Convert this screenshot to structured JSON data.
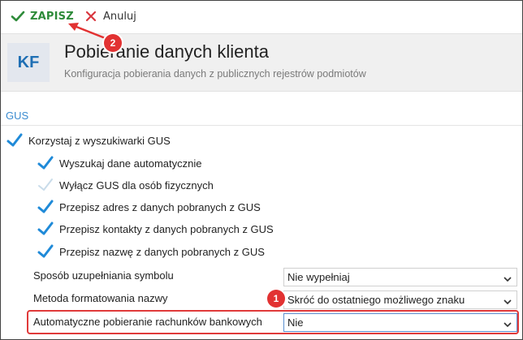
{
  "toolbar": {
    "save_label": "ZAPISZ",
    "cancel_label": "Anuluj"
  },
  "header": {
    "logo_text": "KF",
    "title": "Pobieranie danych klienta",
    "subtitle": "Konfiguracja pobierania danych z publicznych rejestrów podmiotów"
  },
  "section": {
    "title": "GUS"
  },
  "checkboxes": [
    {
      "label": "Korzystaj z wyszukiwarki GUS",
      "checked": true
    },
    {
      "label": "Wyszukaj dane automatycznie",
      "checked": true
    },
    {
      "label": "Wyłącz GUS dla osób fizycznych",
      "checked": false
    },
    {
      "label": "Przepisz adres z danych pobranych z GUS",
      "checked": true
    },
    {
      "label": "Przepisz kontakty z danych pobranych z GUS",
      "checked": true
    },
    {
      "label": "Przepisz nazwę z danych pobranych z GUS",
      "checked": true
    }
  ],
  "fields": [
    {
      "label": "Sposób uzupełniania symbolu",
      "value": "Nie wypełniaj"
    },
    {
      "label": "Metoda formatowania nazwy",
      "value": "Skróć do ostatniego możliwego znaku"
    },
    {
      "label": "Automatyczne pobieranie rachunków bankowych",
      "value": "Nie"
    }
  ],
  "callouts": {
    "one": "1",
    "two": "2"
  },
  "colors": {
    "accent": "#2e8b3a",
    "check": "#1f8ad8",
    "cancel": "#d9363e",
    "highlight": "#e03a3a",
    "section": "#3a8bd0",
    "logo_bg": "#e3e7ee",
    "logo_fg": "#1f6fb4"
  },
  "icons": {
    "save": "check-icon",
    "cancel": "close-icon",
    "dropdown": "chevron-down-icon"
  }
}
